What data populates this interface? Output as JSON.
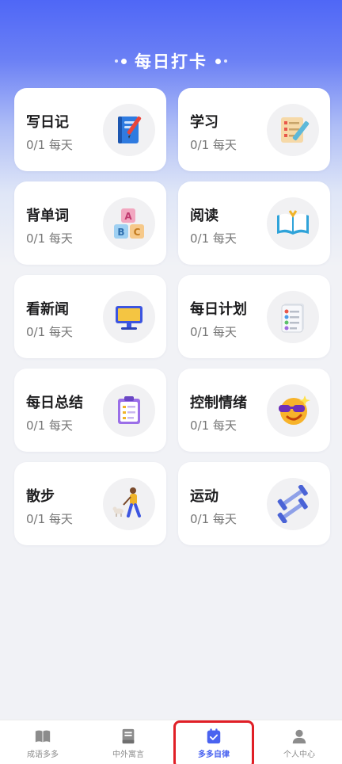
{
  "header": {
    "title": "每日打卡"
  },
  "cards": [
    {
      "name": "写日记",
      "progress": "0/1 每天",
      "icon": "notebook-pen-icon"
    },
    {
      "name": "学习",
      "progress": "0/1 每天",
      "icon": "checklist-pencil-icon"
    },
    {
      "name": "背单词",
      "progress": "0/1 每天",
      "icon": "abc-blocks-icon"
    },
    {
      "name": "阅读",
      "progress": "0/1 每天",
      "icon": "open-book-icon"
    },
    {
      "name": "看新闻",
      "progress": "0/1 每天",
      "icon": "monitor-icon"
    },
    {
      "name": "每日计划",
      "progress": "0/1 每天",
      "icon": "list-paper-icon"
    },
    {
      "name": "每日总结",
      "progress": "0/1 每天",
      "icon": "clipboard-icon"
    },
    {
      "name": "控制情绪",
      "progress": "0/1 每天",
      "icon": "sunglasses-emoji-icon"
    },
    {
      "name": "散步",
      "progress": "0/1 每天",
      "icon": "walking-dog-icon"
    },
    {
      "name": "运动",
      "progress": "0/1 每天",
      "icon": "dumbbell-icon"
    }
  ],
  "tabbar": {
    "items": [
      {
        "label": "成语多多",
        "icon": "book-icon",
        "active": false
      },
      {
        "label": "中外寓言",
        "icon": "document-icon",
        "active": false
      },
      {
        "label": "多多自律",
        "icon": "calendar-check-icon",
        "active": true
      },
      {
        "label": "个人中心",
        "icon": "person-icon",
        "active": false
      }
    ]
  },
  "colors": {
    "accent": "#4a63f0",
    "highlight_box": "#e01f26"
  }
}
